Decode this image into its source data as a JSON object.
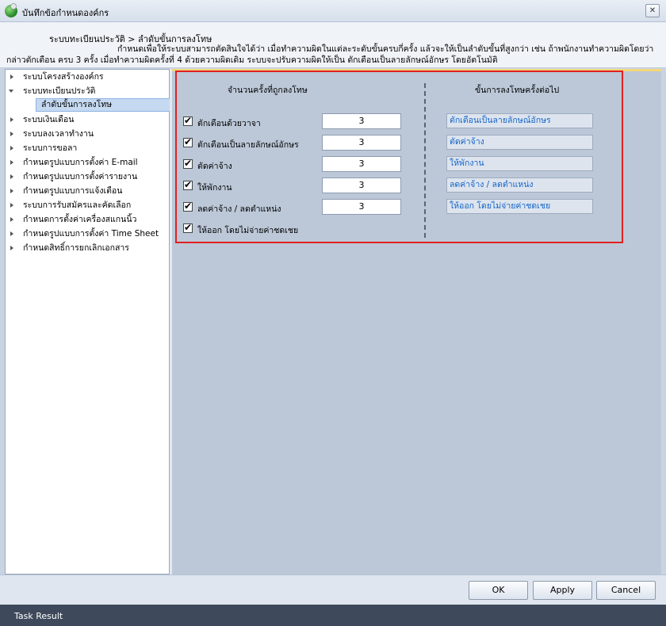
{
  "window": {
    "title": "บันทึกข้อกำหนดองค์กร",
    "close_glyph": "✕"
  },
  "header": {
    "breadcrumb": "ระบบทะเบียนประวัติ > ลำดับขั้นการลงโทษ",
    "description": "กำหนดเพื่อให้ระบบสามารถตัดสินใจได้ว่า เมื่อทำความผิดในแต่ละระดับขั้นครบกี่ครั้ง แล้วจะให้เป็นลำดับขั้นที่สูงกว่า เช่น ถ้าพนักงานทำความผิดโดยว่ากล่าวตักเตือน ครบ 3 ครั้ง เมื่อทำความผิดครั้งที่ 4 ด้วยความผิดเดิม ระบบจะปรับความผิดให้เป็น ตักเตือนเป็นลายลักษณ์อักษร โดยอัตโนมัติ"
  },
  "tree": {
    "items": [
      {
        "label": "ระบบโครงสร้างองค์กร"
      },
      {
        "label": "ระบบทะเบียนประวัติ"
      },
      {
        "label": "ลำดับขั้นการลงโทษ"
      },
      {
        "label": "ระบบเงินเดือน"
      },
      {
        "label": "ระบบลงเวลาทำงาน"
      },
      {
        "label": "ระบบการขอลา"
      },
      {
        "label": "กำหนดรูปแบบการตั้งค่า E-mail"
      },
      {
        "label": "กำหนดรูปแบบการตั้งค่ารายงาน"
      },
      {
        "label": "กำหนดรูปแบบการแจ้งเตือน"
      },
      {
        "label": "ระบบการรับสมัครและคัดเลือก"
      },
      {
        "label": "กำหนดการตั้งค่าเครื่องสแกนนิ้ว"
      },
      {
        "label": "กำหนดรูปแบบการตั้งค่า Time Sheet"
      },
      {
        "label": "กำหนดสิทธิ์การยกเลิกเอกสาร"
      }
    ]
  },
  "panel": {
    "left_header": "จำนวนครั้งที่ถูกลงโทษ",
    "right_header": "ขั้นการลงโทษครั้งต่อไป",
    "rows": [
      {
        "label": "ตักเตือนด้วยวาจา",
        "count": "3",
        "next": "ตักเตือนเป็นลายลักษณ์อักษร"
      },
      {
        "label": "ตักเตือนเป็นลายลักษณ์อักษร",
        "count": "3",
        "next": "ตัดค่าจ้าง"
      },
      {
        "label": "ตัดค่าจ้าง",
        "count": "3",
        "next": "ให้พักงาน"
      },
      {
        "label": "ให้พักงาน",
        "count": "3",
        "next": "ลดค่าจ้าง / ลดตำแหน่ง"
      },
      {
        "label": "ลดค่าจ้าง / ลดตำแหน่ง",
        "count": "3",
        "next": "ให้ออก โดยไม่จ่ายค่าชดเชย"
      },
      {
        "label": "ให้ออก โดยไม่จ่ายค่าชดเชย"
      }
    ]
  },
  "buttons": {
    "ok": "OK",
    "apply": "Apply",
    "cancel": "Cancel"
  },
  "status": {
    "text": "Task Result"
  }
}
